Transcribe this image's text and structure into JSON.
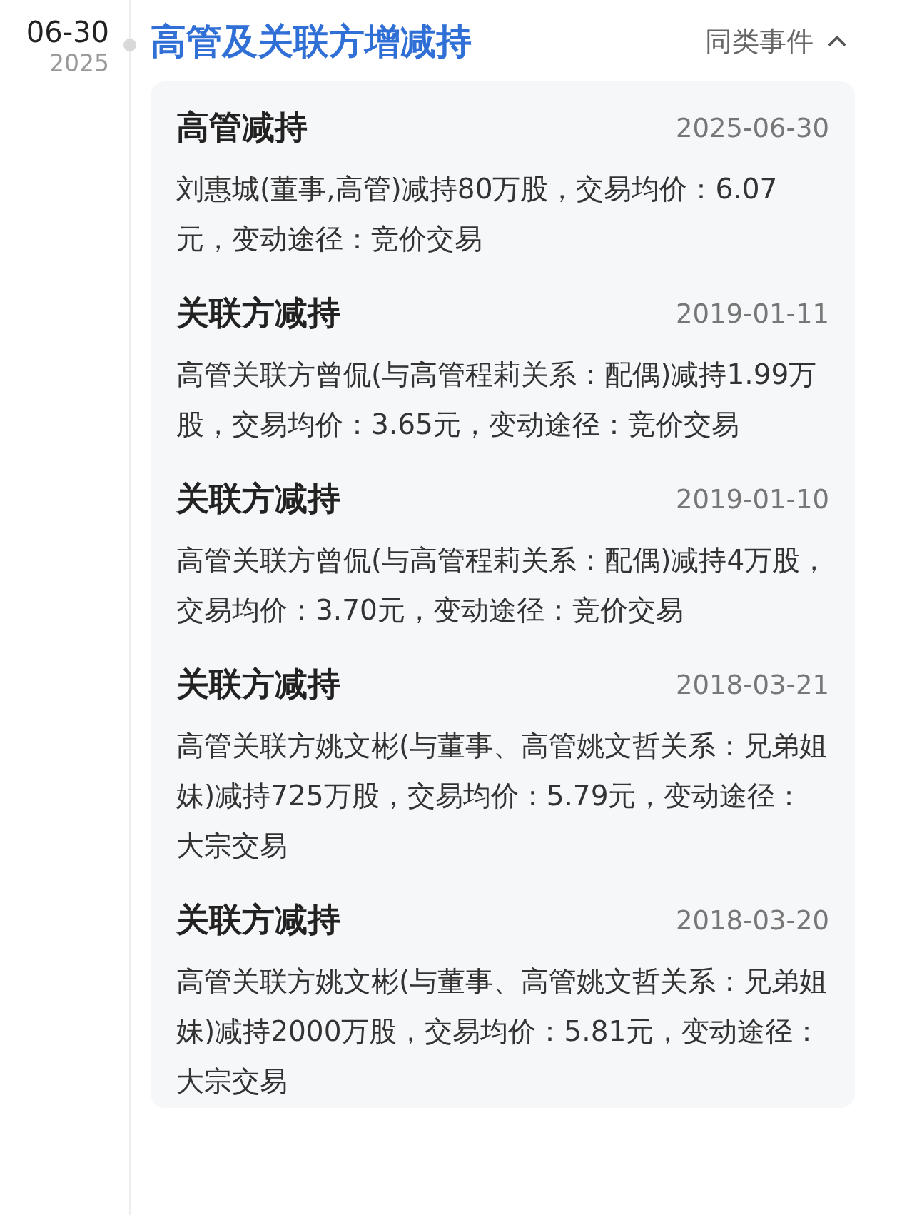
{
  "event": {
    "date": "06-30",
    "year": "2025",
    "title": "高管及关联方增减持",
    "similar_events": {
      "label": "同类事件",
      "expanded": true
    },
    "items": [
      {
        "title": "高管减持",
        "date": "2025-06-30",
        "text": "刘惠城(董事,高管)减持80万股，交易均价：6.07元，变动途径：竞价交易"
      },
      {
        "title": "关联方减持",
        "date": "2019-01-11",
        "text": "高管关联方曾侃(与高管程莉关系：配偶)减持1.99万股，交易均价：3.65元，变动途径：竞价交易"
      },
      {
        "title": "关联方减持",
        "date": "2019-01-10",
        "text": "高管关联方曾侃(与高管程莉关系：配偶)减持4万股，交易均价：3.70元，变动途径：竞价交易"
      },
      {
        "title": "关联方减持",
        "date": "2018-03-21",
        "text": "高管关联方姚文彬(与董事、高管姚文哲关系：兄弟姐妹)减持725万股，交易均价：5.79元，变动途径：大宗交易"
      },
      {
        "title": "关联方减持",
        "date": "2018-03-20",
        "text": "高管关联方姚文彬(与董事、高管姚文哲关系：兄弟姐妹)减持2000万股，交易均价：5.81元，变动途径：大宗交易"
      }
    ]
  }
}
